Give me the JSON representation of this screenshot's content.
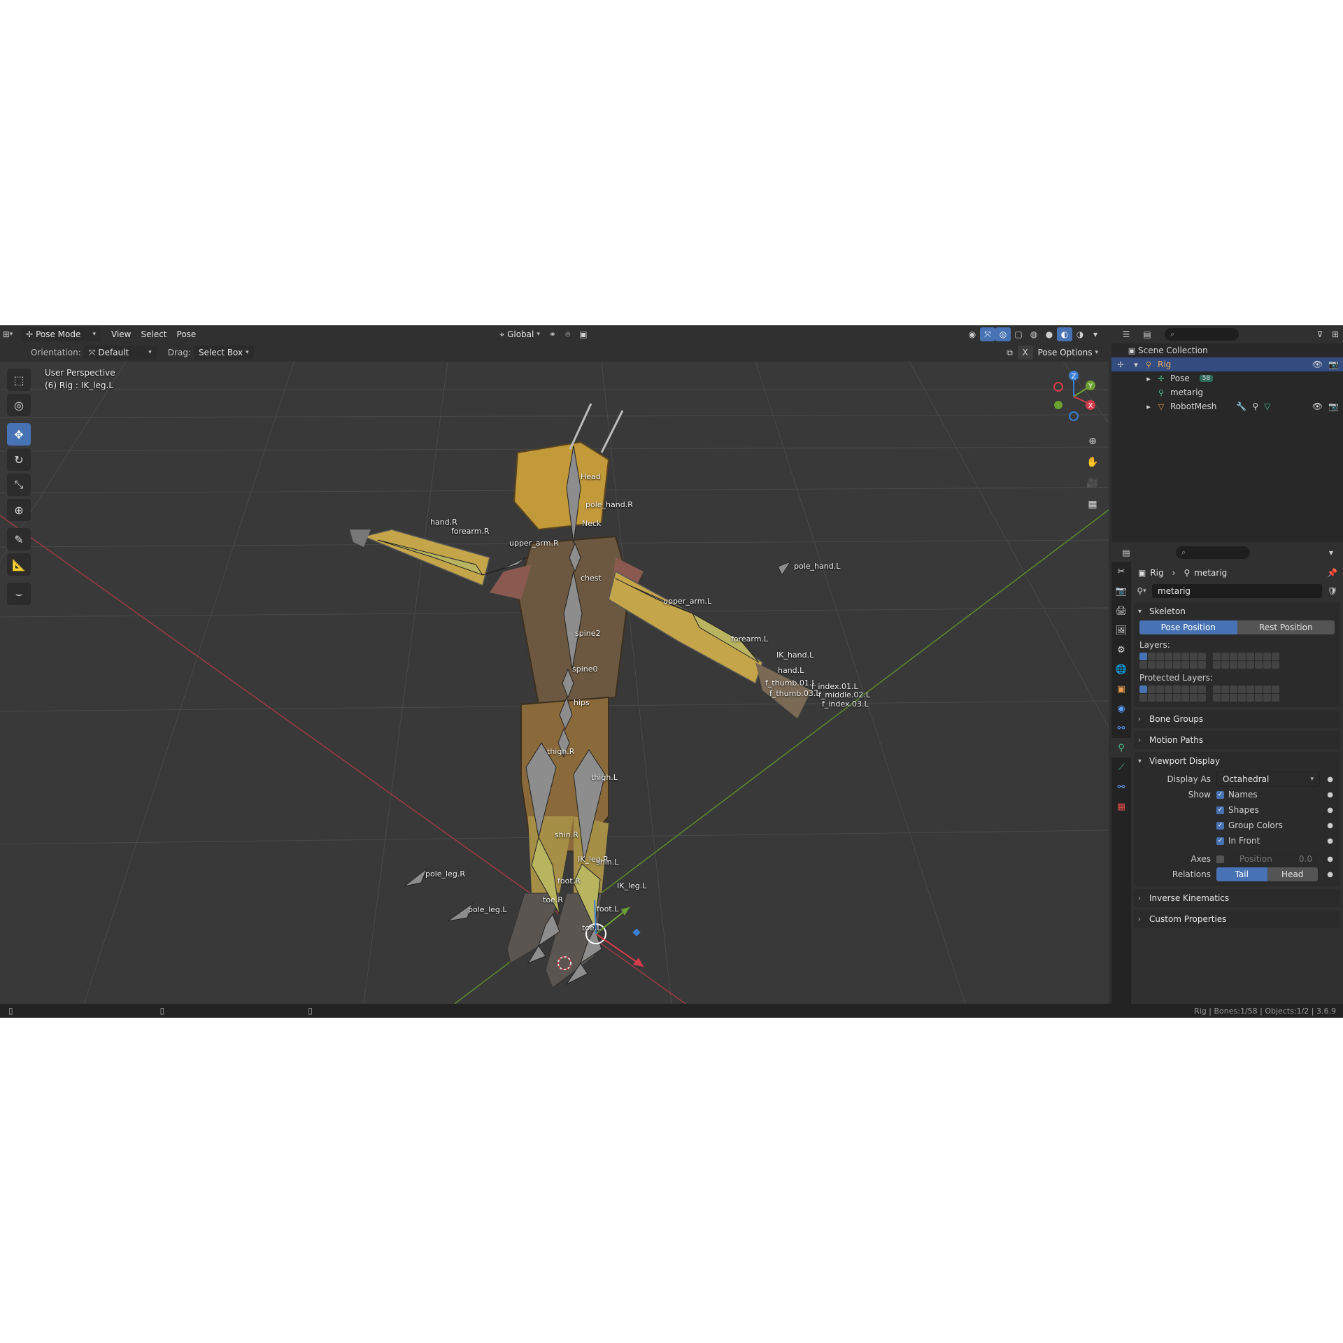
{
  "header": {
    "mode": "Pose Mode",
    "menus": [
      "View",
      "Select",
      "Pose"
    ],
    "orientation_global": "Global",
    "orientation_label": "Orientation:",
    "orientation_value": "Default",
    "drag_label": "Drag:",
    "drag_value": "Select Box",
    "pose_options": "Pose Options"
  },
  "overlay": {
    "view_name": "User Perspective",
    "active": "(6) Rig : IK_leg.L"
  },
  "bones": [
    "Head",
    "pole_hand.R",
    "Neck",
    "forearm.R",
    "upper_arm.R",
    "chest",
    "upper_arm.L",
    "pole_hand.L",
    "forearm.L",
    "IK_hand.L",
    "hand.L",
    "spine2",
    "spine0",
    "hips",
    "thigh.R",
    "thigh.L",
    "shin.R",
    "IK_leg.R",
    "shin.L",
    "IK_leg.L",
    "foot.R",
    "foot.L",
    "toe.R",
    "toe.L",
    "pole_leg.R",
    "pole_leg.L",
    "hand.R",
    "f_thumb.01.L",
    "f_index.01.L",
    "f_thumb.03.L",
    "f_middle.02.L",
    "f_index.03.L"
  ],
  "gizmo_axes": [
    "Z",
    "Y",
    "X"
  ],
  "outliner": {
    "search_placeholder": "",
    "items": [
      {
        "label": "Scene Collection"
      },
      {
        "label": "Rig"
      },
      {
        "label": "Pose",
        "badge": "58"
      },
      {
        "label": "metarig"
      },
      {
        "label": "RobotMesh"
      }
    ]
  },
  "properties": {
    "breadcrumb_object": "Rig",
    "breadcrumb_data": "metarig",
    "datablock": "metarig",
    "skeleton": {
      "title": "Skeleton",
      "pose_position": "Pose Position",
      "rest_position": "Rest Position",
      "layers_label": "Layers:",
      "protected_label": "Protected Layers:"
    },
    "panels": {
      "bone_groups": "Bone Groups",
      "motion_paths": "Motion Paths",
      "viewport_display": "Viewport Display",
      "inverse_kinematics": "Inverse Kinematics",
      "custom_properties": "Custom Properties"
    },
    "viewport_display": {
      "display_as_label": "Display As",
      "display_as_value": "Octahedral",
      "show_label": "Show",
      "show_items": [
        "Names",
        "Shapes",
        "Group Colors",
        "In Front"
      ],
      "axes_label": "Axes",
      "axes_position_label": "Position",
      "axes_position_value": "0.0",
      "relations_label": "Relations",
      "relations_tail": "Tail",
      "relations_head": "Head"
    }
  },
  "status": {
    "text": "Rig | Bones:1/58 | Objects:1/2 | 3.6.9"
  },
  "colors": {
    "accent": "#4772b3",
    "x_axis": "#d43b4a",
    "y_axis": "#6da231",
    "z_axis": "#3b7fd4"
  }
}
